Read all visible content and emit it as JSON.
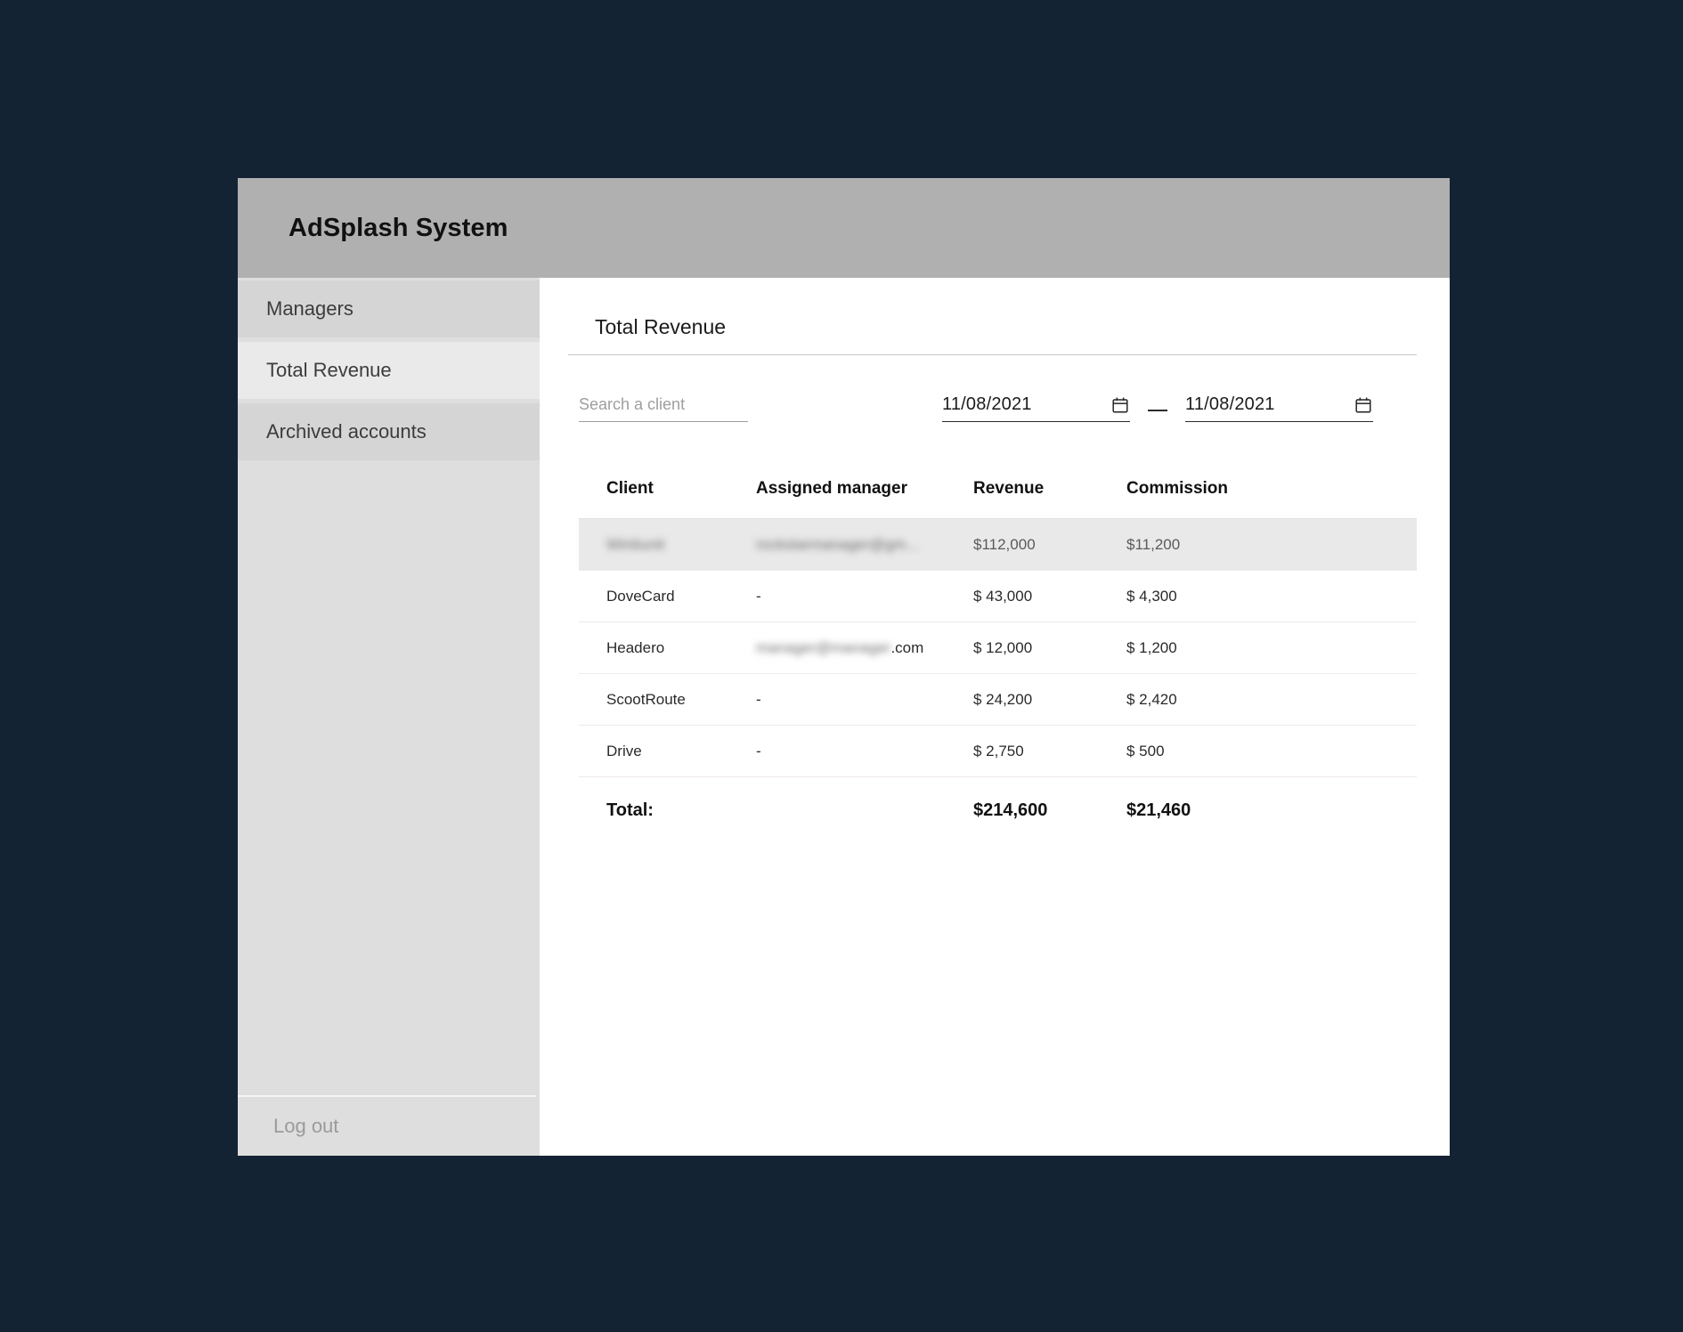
{
  "window": {
    "header_title": "AdSplash System"
  },
  "sidebar": {
    "items": [
      {
        "label": "Managers",
        "state": "normal"
      },
      {
        "label": "Total Revenue",
        "state": "selected"
      },
      {
        "label": "Archived accounts",
        "state": "normal"
      }
    ],
    "logout_label": "Log out"
  },
  "main": {
    "page_title": "Total Revenue",
    "search": {
      "placeholder": "Search a client",
      "value": ""
    },
    "date_range": {
      "start": "11/08/2021",
      "end": "11/08/2021",
      "separator": "—",
      "start_icon": "calendar-icon",
      "end_icon": "calendar-icon"
    },
    "table": {
      "columns": [
        "Client",
        "Assigned manager",
        "Revenue",
        "Commission"
      ],
      "rows": [
        {
          "client": "Wintiunit",
          "manager": "rockstarmanager@gm...",
          "revenue": "$112,000",
          "commission": "$11,200",
          "redacted": true,
          "highlighted": true
        },
        {
          "client": "DoveCard",
          "manager": "-",
          "revenue": "$ 43,000",
          "commission": "$ 4,300",
          "redacted": false,
          "highlighted": false
        },
        {
          "client": "Headero",
          "manager": "manager@manager.com",
          "manager_suffix": ".com",
          "revenue": "$ 12,000",
          "commission": "$ 1,200",
          "redacted": true,
          "highlighted": false
        },
        {
          "client": "ScootRoute",
          "manager": "-",
          "revenue": "$ 24,200",
          "commission": "$ 2,420",
          "redacted": false,
          "highlighted": false
        },
        {
          "client": "Drive",
          "manager": "-",
          "revenue": "$ 2,750",
          "commission": "$ 500",
          "redacted": false,
          "highlighted": false
        }
      ],
      "total": {
        "label": "Total:",
        "manager": "",
        "revenue": "$214,600",
        "commission": "$21,460"
      }
    }
  },
  "colors": {
    "page_background": "#142334",
    "header_bar": "#b0b0b0",
    "sidebar_background": "#dedede",
    "sidebar_item": "#d5d5d5",
    "sidebar_item_selected": "#eaeaea",
    "content_background": "#ffffff",
    "row_highlight": "#e9e9e9",
    "text_primary": "#111111",
    "text_muted": "#9a9a9a"
  }
}
